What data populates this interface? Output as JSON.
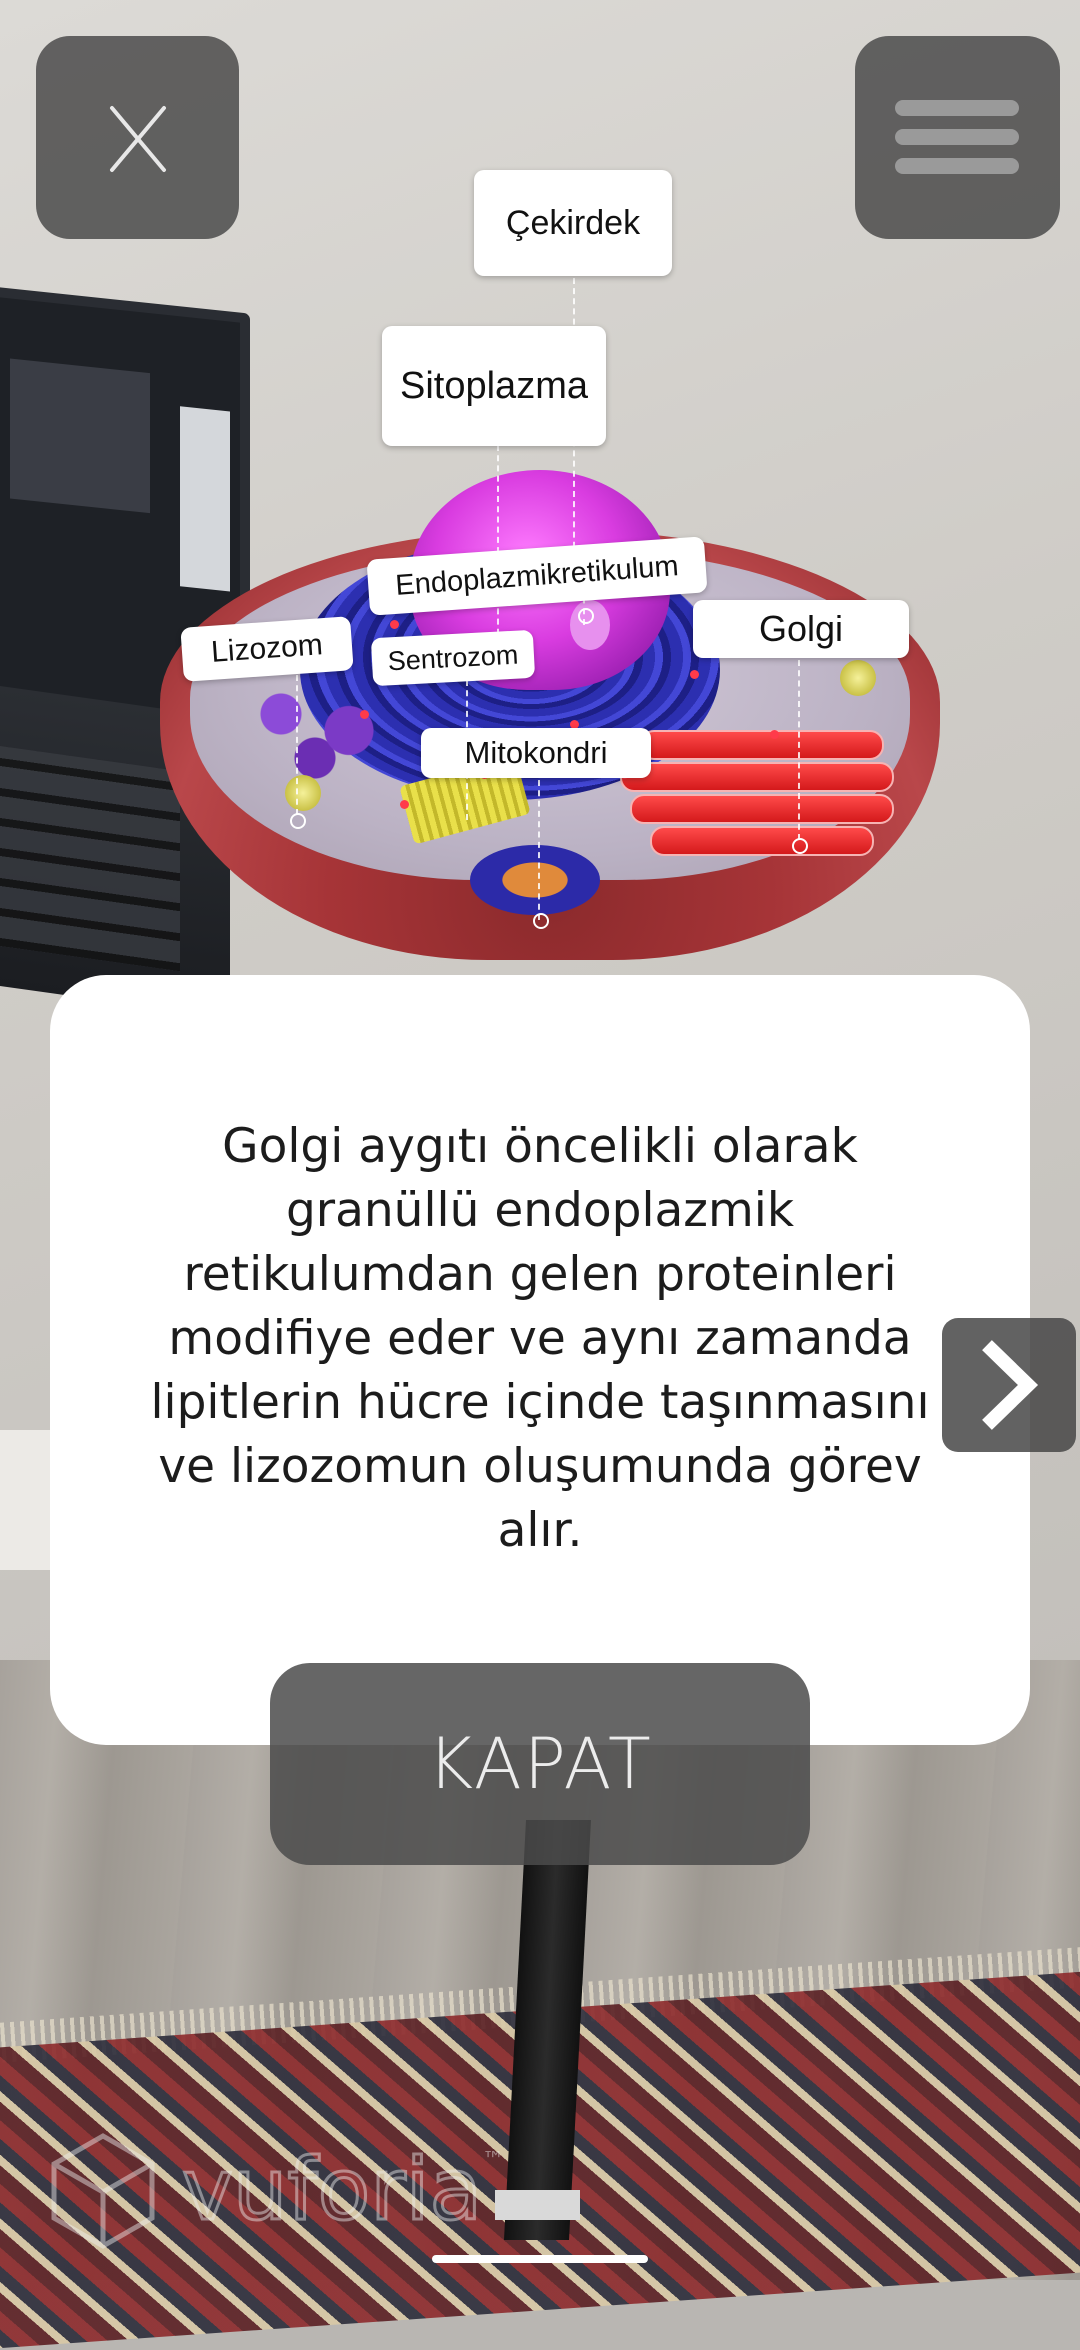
{
  "top_bar": {
    "close_icon": "close-icon",
    "menu_icon": "hamburger-menu-icon"
  },
  "cell_labels": {
    "cekirdek": "Çekirdek",
    "sitoplazma": "Sitoplazma",
    "endoplazmikretikulum": "Endoplazmikretikulum",
    "lizozom": "Lizozom",
    "sentrozom": "Sentrozom",
    "golgi": "Golgi",
    "mitokondri": "Mitokondri"
  },
  "info_card": {
    "text": "Golgi aygıtı öncelikli olarak granüllü endoplazmik retikulumdan gelen proteinleri modifiye eder ve aynı zamanda lipitlerin hücre içinde taşınmasını ve lizozomun oluşumunda görev alır.",
    "next_icon": "chevron-right-icon"
  },
  "close_button": {
    "label": "KAPAT"
  },
  "watermark": {
    "text": "vuforia",
    "tm": "™"
  },
  "colors": {
    "card_bg": "#ffffff",
    "button_bg": "#464646",
    "button_text": "#ececec"
  }
}
